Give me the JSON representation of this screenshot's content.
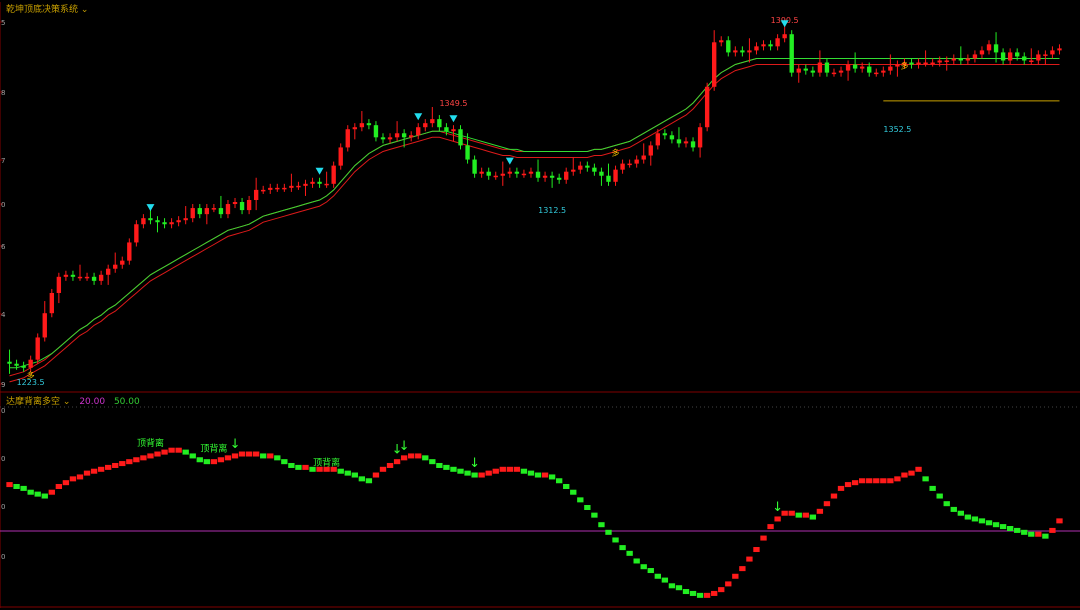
{
  "main_panel": {
    "title": "乾坤顶底决策系统",
    "title_color": "#c8a000"
  },
  "sub_panel": {
    "title": "达摩背离多空",
    "title_color": "#c8a000",
    "param1": "20.00",
    "param1_color": "#cc33cc",
    "param2": "50.00",
    "param2_color": "#33cc33"
  },
  "colors": {
    "background": "#000000",
    "up": "#ff1a1a",
    "down": "#22ee22",
    "band": "#dd1a1a",
    "ma": "#33dd33",
    "axis_line": "#800000",
    "purple_line": "#b030b0",
    "marker": "#22ddee",
    "duo_label": "#ffcc00",
    "high_label": "#ff4444",
    "low_label": "#33ccdd",
    "signal_label": "#33ff33",
    "arrow": "#33ff33"
  },
  "axis_ticks": [
    "5",
    "8",
    "7",
    "0",
    "6",
    "4",
    "9"
  ],
  "sub_axis_ticks": [
    "0",
    "0",
    "0",
    "0"
  ],
  "chart_data": [
    {
      "type": "candlestick",
      "name": "main",
      "price_labels": [
        {
          "text": "1390.5",
          "kind": "high"
        },
        {
          "text": "1349.5",
          "kind": "high"
        },
        {
          "text": "1312.5",
          "kind": "low"
        },
        {
          "text": "1352.5",
          "kind": "low"
        },
        {
          "text": "1223.5",
          "kind": "low"
        }
      ],
      "signal_text": "多",
      "candle_count": 150,
      "open": [
        1228,
        1227,
        1226,
        1225,
        1229,
        1240,
        1252,
        1262,
        1270,
        1271,
        1270,
        1270,
        1270,
        1268,
        1271,
        1274,
        1276,
        1278,
        1287,
        1296,
        1299,
        1298,
        1297,
        1296,
        1297,
        1298,
        1299,
        1304,
        1301,
        1304,
        1304,
        1301,
        1306,
        1307,
        1303,
        1308,
        1313,
        1313,
        1314,
        1314,
        1314,
        1315,
        1315,
        1316,
        1317,
        1316,
        1316,
        1325,
        1334,
        1343,
        1344,
        1346,
        1345,
        1339,
        1338,
        1339,
        1341,
        1339,
        1340,
        1344,
        1346,
        1348,
        1344,
        1342,
        1343,
        1335,
        1328,
        1321,
        1322,
        1320,
        1320,
        1321,
        1322,
        1321,
        1321,
        1322,
        1319,
        1320,
        1319,
        1318,
        1322,
        1323,
        1325,
        1324,
        1322,
        1320,
        1317,
        1323,
        1326,
        1326,
        1328,
        1330,
        1335,
        1341,
        1340,
        1338,
        1336,
        1337,
        1334,
        1344,
        1364,
        1386,
        1387,
        1381,
        1382,
        1381,
        1382,
        1384,
        1385,
        1384,
        1388,
        1390,
        1371,
        1373,
        1372,
        1371,
        1376,
        1371,
        1371,
        1372,
        1375,
        1373,
        1374,
        1371,
        1371,
        1372,
        1374,
        1375,
        1376,
        1375,
        1376,
        1376,
        1376,
        1377,
        1377,
        1378,
        1377,
        1378,
        1380,
        1382,
        1385,
        1381,
        1377,
        1381,
        1379,
        1377,
        1377,
        1380,
        1380,
        1382
      ],
      "close": [
        1227,
        1226,
        1225,
        1229,
        1240,
        1252,
        1262,
        1270,
        1271,
        1270,
        1270,
        1270,
        1268,
        1271,
        1274,
        1276,
        1278,
        1287,
        1296,
        1299,
        1298,
        1297,
        1296,
        1297,
        1298,
        1299,
        1304,
        1301,
        1304,
        1304,
        1301,
        1306,
        1307,
        1303,
        1308,
        1313,
        1313,
        1314,
        1314,
        1314,
        1315,
        1315,
        1316,
        1317,
        1316,
        1316,
        1325,
        1334,
        1343,
        1344,
        1346,
        1345,
        1339,
        1338,
        1339,
        1341,
        1339,
        1340,
        1344,
        1346,
        1348,
        1344,
        1342,
        1343,
        1335,
        1328,
        1321,
        1322,
        1320,
        1320,
        1321,
        1322,
        1321,
        1321,
        1322,
        1319,
        1320,
        1319,
        1318,
        1322,
        1323,
        1325,
        1324,
        1322,
        1320,
        1317,
        1323,
        1326,
        1326,
        1328,
        1330,
        1335,
        1341,
        1340,
        1338,
        1336,
        1337,
        1334,
        1344,
        1364,
        1386,
        1387,
        1381,
        1382,
        1381,
        1382,
        1384,
        1385,
        1384,
        1388,
        1390,
        1371,
        1373,
        1372,
        1371,
        1376,
        1371,
        1371,
        1372,
        1375,
        1373,
        1374,
        1371,
        1371,
        1372,
        1374,
        1375,
        1376,
        1375,
        1376,
        1376,
        1376,
        1377,
        1377,
        1378,
        1377,
        1378,
        1380,
        1382,
        1385,
        1381,
        1377,
        1381,
        1379,
        1377,
        1377,
        1380,
        1380,
        1382,
        1383
      ],
      "band_upper": [
        1221,
        1222,
        1223,
        1225,
        1227,
        1229,
        1232,
        1235,
        1238,
        1241,
        1244,
        1246,
        1249,
        1251,
        1254,
        1256,
        1259,
        1262,
        1265,
        1268,
        1271,
        1273,
        1275,
        1277,
        1279,
        1281,
        1283,
        1285,
        1287,
        1289,
        1291,
        1293,
        1294,
        1295,
        1296,
        1298,
        1300,
        1301,
        1302,
        1303,
        1304,
        1305,
        1306,
        1307,
        1308,
        1310,
        1313,
        1317,
        1321,
        1325,
        1328,
        1331,
        1333,
        1335,
        1336,
        1337,
        1338,
        1339,
        1340,
        1341,
        1342,
        1342,
        1341,
        1340,
        1339,
        1338,
        1337,
        1336,
        1335,
        1334,
        1333,
        1333,
        1332,
        1332,
        1332,
        1332,
        1332,
        1332,
        1332,
        1332,
        1332,
        1332,
        1332,
        1333,
        1333,
        1334,
        1335,
        1336,
        1337,
        1339,
        1341,
        1343,
        1345,
        1347,
        1349,
        1351,
        1353,
        1356,
        1360,
        1364,
        1368,
        1371,
        1373,
        1375,
        1376,
        1377,
        1378,
        1378,
        1378,
        1378,
        1378,
        1378,
        1378,
        1378,
        1378,
        1378,
        1378,
        1378,
        1378,
        1378,
        1378,
        1378,
        1378,
        1378,
        1378,
        1378,
        1378,
        1378,
        1378,
        1378,
        1378,
        1378,
        1378,
        1378,
        1378,
        1378,
        1378,
        1378,
        1378,
        1378,
        1378,
        1378,
        1378,
        1378,
        1378,
        1378,
        1378,
        1378,
        1378,
        1378
      ],
      "band_lower": [
        1218,
        1219,
        1220,
        1222,
        1224,
        1226,
        1229,
        1232,
        1235,
        1238,
        1241,
        1243,
        1246,
        1248,
        1251,
        1253,
        1256,
        1259,
        1262,
        1265,
        1268,
        1270,
        1272,
        1274,
        1276,
        1278,
        1280,
        1282,
        1284,
        1286,
        1288,
        1290,
        1291,
        1292,
        1293,
        1295,
        1297,
        1298,
        1299,
        1300,
        1301,
        1302,
        1303,
        1304,
        1305,
        1307,
        1310,
        1314,
        1318,
        1322,
        1325,
        1328,
        1330,
        1332,
        1333,
        1334,
        1335,
        1336,
        1337,
        1338,
        1339,
        1339,
        1338,
        1337,
        1336,
        1335,
        1334,
        1333,
        1332,
        1331,
        1330,
        1330,
        1329,
        1329,
        1329,
        1329,
        1329,
        1329,
        1329,
        1329,
        1329,
        1329,
        1329,
        1330,
        1330,
        1331,
        1332,
        1333,
        1334,
        1336,
        1338,
        1340,
        1342,
        1344,
        1346,
        1348,
        1350,
        1353,
        1357,
        1361,
        1365,
        1368,
        1370,
        1372,
        1373,
        1374,
        1375,
        1375,
        1375,
        1375,
        1375,
        1375,
        1375,
        1375,
        1375,
        1375,
        1375,
        1375,
        1375,
        1375,
        1375,
        1375,
        1375,
        1375,
        1375,
        1375,
        1375,
        1375,
        1375,
        1375,
        1375,
        1375,
        1375,
        1375,
        1375,
        1375,
        1375,
        1375,
        1375,
        1375,
        1375,
        1375,
        1375,
        1375,
        1375,
        1375,
        1375,
        1375,
        1375,
        1375
      ],
      "ma": [
        1225,
        1225,
        1226,
        1227,
        1228,
        1230,
        1232,
        1235,
        1238,
        1241,
        1244,
        1246,
        1249,
        1251,
        1254,
        1256,
        1259,
        1262,
        1265,
        1268,
        1271,
        1273,
        1275,
        1277,
        1279,
        1281,
        1283,
        1285,
        1287,
        1289,
        1291,
        1293,
        1294,
        1295,
        1296,
        1298,
        1300,
        1301,
        1302,
        1303,
        1304,
        1305,
        1306,
        1307,
        1308,
        1310,
        1313,
        1317,
        1321,
        1325,
        1328,
        1331,
        1333,
        1335,
        1336,
        1337,
        1338,
        1339,
        1340,
        1341,
        1342,
        1342,
        1342,
        1341,
        1340,
        1339,
        1338,
        1337,
        1336,
        1335,
        1334,
        1333,
        1333,
        1332,
        1332,
        1332,
        1332,
        1332,
        1332,
        1332,
        1332,
        1332,
        1332,
        1333,
        1333,
        1334,
        1335,
        1336,
        1337,
        1339,
        1341,
        1343,
        1345,
        1347,
        1349,
        1351,
        1353,
        1356,
        1360,
        1364,
        1368,
        1371,
        1373,
        1375,
        1376,
        1377,
        1378,
        1378,
        1378,
        1378,
        1378,
        1378,
        1378,
        1378,
        1378,
        1378,
        1378,
        1378,
        1378,
        1378,
        1378,
        1378,
        1378,
        1378,
        1378,
        1378,
        1378,
        1378,
        1378,
        1378,
        1378,
        1378,
        1378,
        1378,
        1378,
        1378,
        1378,
        1378,
        1378,
        1378,
        1378,
        1378,
        1378,
        1378,
        1378,
        1378,
        1378,
        1378,
        1378,
        1378
      ]
    },
    {
      "type": "bar",
      "name": "sub",
      "signal_text": "顶背离",
      "values": [
        62,
        61,
        60,
        58,
        57,
        56,
        58,
        61,
        63,
        65,
        66,
        68,
        69,
        70,
        71,
        72,
        73,
        74,
        75,
        76,
        77,
        78,
        79,
        80,
        80,
        79,
        77,
        75,
        74,
        74,
        75,
        76,
        77,
        78,
        78,
        78,
        77,
        77,
        76,
        74,
        72,
        71,
        71,
        70,
        70,
        70,
        70,
        69,
        68,
        67,
        65,
        64,
        67,
        70,
        72,
        74,
        76,
        77,
        77,
        76,
        74,
        72,
        71,
        70,
        69,
        68,
        67,
        67,
        68,
        69,
        70,
        70,
        70,
        69,
        68,
        67,
        67,
        66,
        64,
        61,
        58,
        54,
        50,
        46,
        41,
        37,
        33,
        29,
        26,
        22,
        19,
        17,
        14,
        12,
        9,
        8,
        6,
        5,
        4,
        4,
        5,
        7,
        10,
        14,
        18,
        23,
        28,
        34,
        40,
        44,
        47,
        47,
        46,
        46,
        45,
        48,
        52,
        56,
        60,
        62,
        63,
        64,
        64,
        64,
        64,
        64,
        65,
        67,
        68,
        70,
        65,
        60,
        56,
        52,
        49,
        47,
        45,
        44,
        43,
        42,
        41,
        40,
        39,
        38,
        37,
        36,
        36,
        35,
        38,
        43
      ]
    }
  ]
}
